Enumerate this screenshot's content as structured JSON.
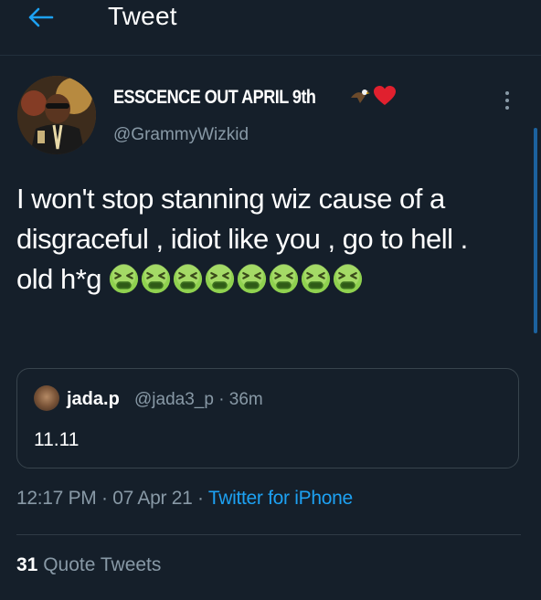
{
  "header": {
    "title": "Tweet",
    "back_icon": "arrow-left-icon",
    "accent": "#1da1f2"
  },
  "tweet": {
    "display_name": "ESSCENCE OUT APRIL 9th",
    "name_badges": [
      "eagle-emoji",
      "red-heart-emoji"
    ],
    "handle": "@GrammyWizkid",
    "text": "I won't stop stanning wiz cause of a disgraceful , idiot like you , go to hell . old h*g",
    "emoji": "nauseated-face-emoji",
    "emoji_count": 8,
    "timestamp": "12:17 PM · 07 Apr 21 · ",
    "source": "Twitter for iPhone"
  },
  "quote": {
    "name": "jada.p",
    "meta": "@jada3_p · 36m",
    "text": "11.11"
  },
  "stats": {
    "quote_tweets_count": "31",
    "quote_tweets_label": " Quote Tweets"
  }
}
